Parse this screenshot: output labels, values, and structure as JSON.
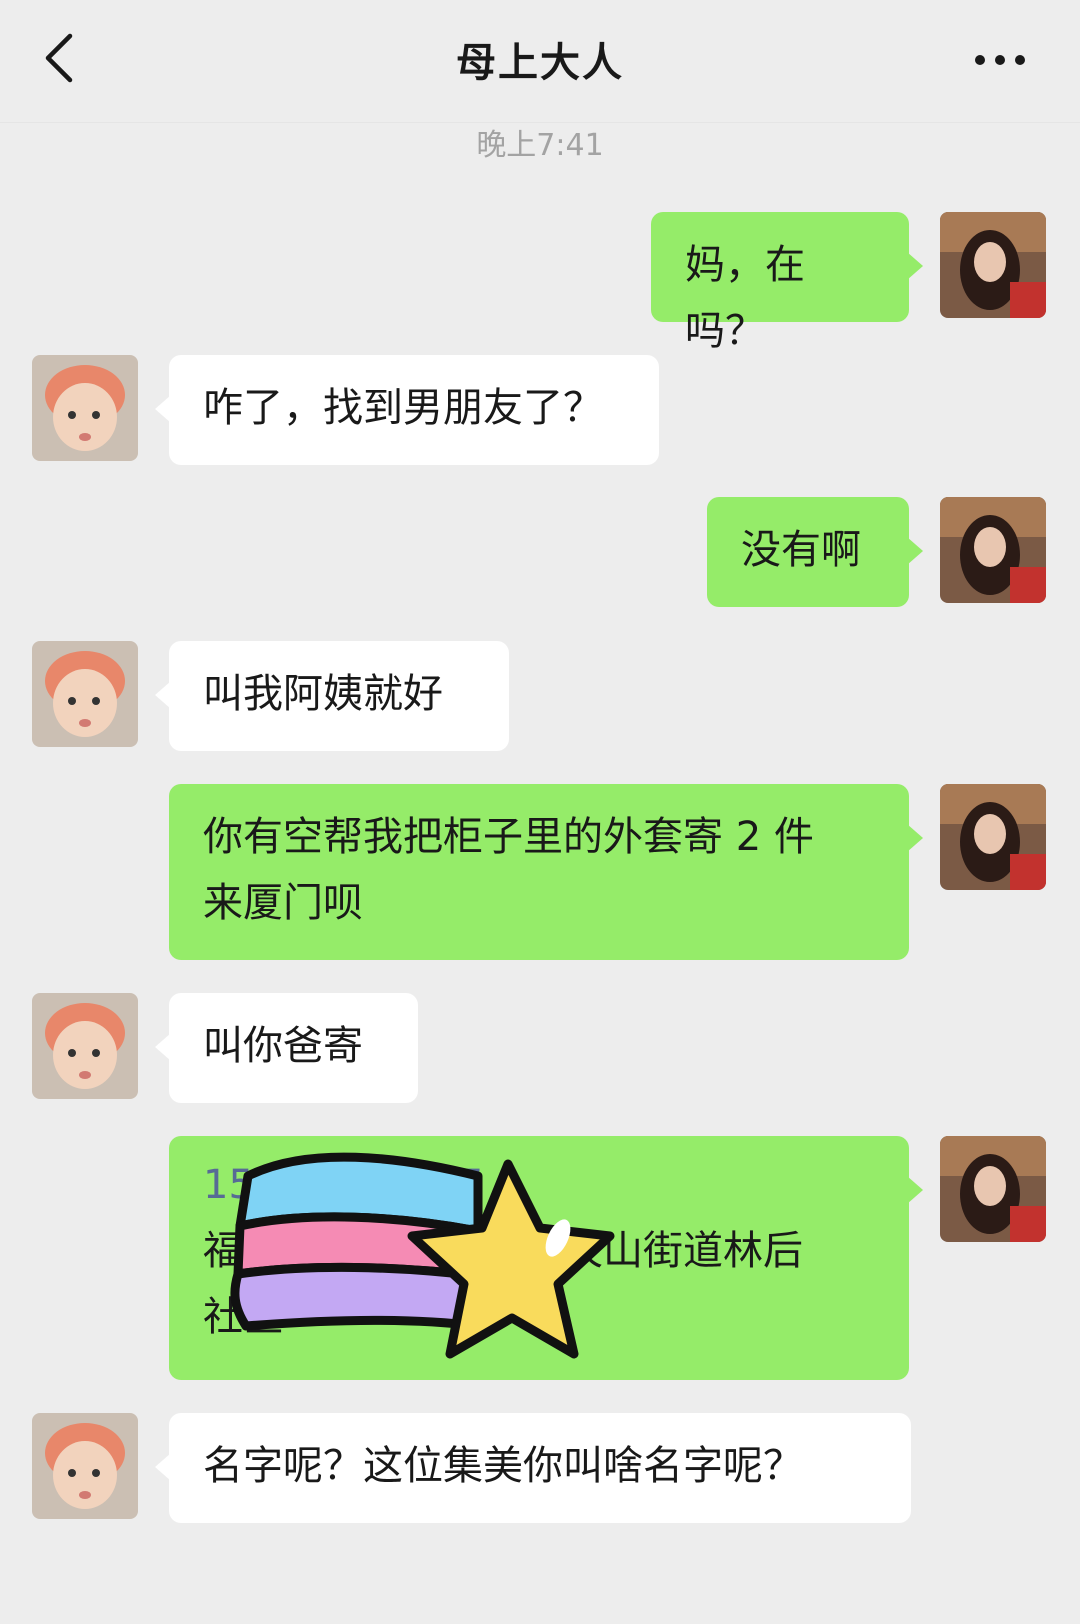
{
  "header": {
    "title": "母上大人",
    "back_icon": "chevron-left-icon",
    "more_icon": "ellipsis-icon"
  },
  "timestamp": "晚上7:41",
  "messages": [
    {
      "from": "me",
      "text": "妈，在吗？"
    },
    {
      "from": "mom",
      "text": "咋了，找到男朋友了？"
    },
    {
      "from": "me",
      "text": "没有啊"
    },
    {
      "from": "mom",
      "text": "叫我阿姨就好"
    },
    {
      "from": "me",
      "lines": [
        "你有空帮我把柜子里的外套寄 2 件",
        "来厦门呗"
      ]
    },
    {
      "from": "mom",
      "text": "叫你爸寄"
    },
    {
      "from": "me",
      "phone": "15977777777",
      "lines": [
        "福建省厦门市思明区天山街道林后",
        "社区"
      ]
    },
    {
      "from": "mom",
      "text": "名字呢？这位集美你叫啥名字呢？"
    }
  ],
  "colors": {
    "background": "#ededed",
    "my_bubble": "#95ec69",
    "their_bubble": "#ffffff",
    "link": "#576b95"
  }
}
